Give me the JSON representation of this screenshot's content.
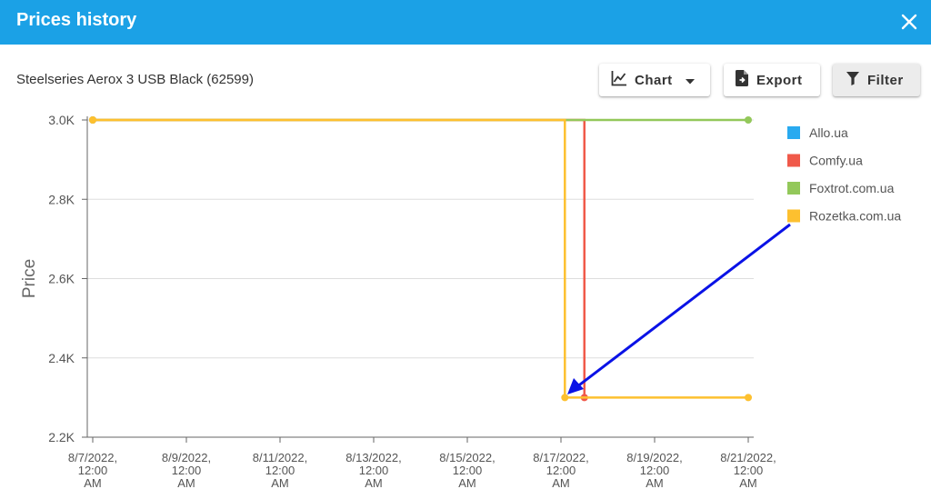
{
  "dialog": {
    "title": "Prices history",
    "close_icon": "close-icon"
  },
  "product": {
    "name": "Steelseries Aerox 3 USB Black (62599)"
  },
  "toolbar": {
    "chart_label": "Chart",
    "chart_icon": "line-chart-icon",
    "export_label": "Export",
    "export_icon": "file-export-icon",
    "filter_label": "Filter",
    "filter_icon": "filter-icon"
  },
  "colors": {
    "header": "#1ba1e6",
    "annotation_arrow": "#0a12e6"
  },
  "chart_data": {
    "type": "line",
    "ylabel": "Price",
    "xlabel": "",
    "ylim": [
      2200,
      3000
    ],
    "yticks": [
      {
        "value": 3000,
        "label": "3.0K"
      },
      {
        "value": 2800,
        "label": "2.8K"
      },
      {
        "value": 2600,
        "label": "2.6K"
      },
      {
        "value": 2400,
        "label": "2.4K"
      },
      {
        "value": 2200,
        "label": "2.2K"
      }
    ],
    "xlim": [
      "2022-08-07",
      "2022-08-21"
    ],
    "xticks": [
      {
        "date": "2022-08-07",
        "label": [
          "8/7/2022,",
          "12:00",
          "AM"
        ]
      },
      {
        "date": "2022-08-09",
        "label": [
          "8/9/2022,",
          "12:00",
          "AM"
        ]
      },
      {
        "date": "2022-08-11",
        "label": [
          "8/11/2022,",
          "12:00",
          "AM"
        ]
      },
      {
        "date": "2022-08-13",
        "label": [
          "8/13/2022,",
          "12:00",
          "AM"
        ]
      },
      {
        "date": "2022-08-15",
        "label": [
          "8/15/2022,",
          "12:00",
          "AM"
        ]
      },
      {
        "date": "2022-08-17",
        "label": [
          "8/17/2022,",
          "12:00",
          "AM"
        ]
      },
      {
        "date": "2022-08-19",
        "label": [
          "8/19/2022,",
          "12:00",
          "AM"
        ]
      },
      {
        "date": "2022-08-21",
        "label": [
          "8/21/2022,",
          "12:00",
          "AM"
        ]
      }
    ],
    "grid": true,
    "step": true,
    "legend_position": "right",
    "series": [
      {
        "name": "Allo.ua",
        "color": "#29aaf0",
        "points": []
      },
      {
        "name": "Comfy.ua",
        "color": "#f0594a",
        "points": [
          {
            "x": "2022-08-07",
            "y": 3000
          },
          {
            "x": "2022-08-17 12:00",
            "y": 2300
          }
        ]
      },
      {
        "name": "Foxtrot.com.ua",
        "color": "#93c85a",
        "points": [
          {
            "x": "2022-08-07",
            "y": 3000
          },
          {
            "x": "2022-08-21",
            "y": 3000
          }
        ]
      },
      {
        "name": "Rozetka.com.ua",
        "color": "#fdc02f",
        "points": [
          {
            "x": "2022-08-07",
            "y": 3000
          },
          {
            "x": "2022-08-17 02:00",
            "y": 2300
          },
          {
            "x": "2022-08-21",
            "y": 2300
          }
        ]
      }
    ]
  }
}
